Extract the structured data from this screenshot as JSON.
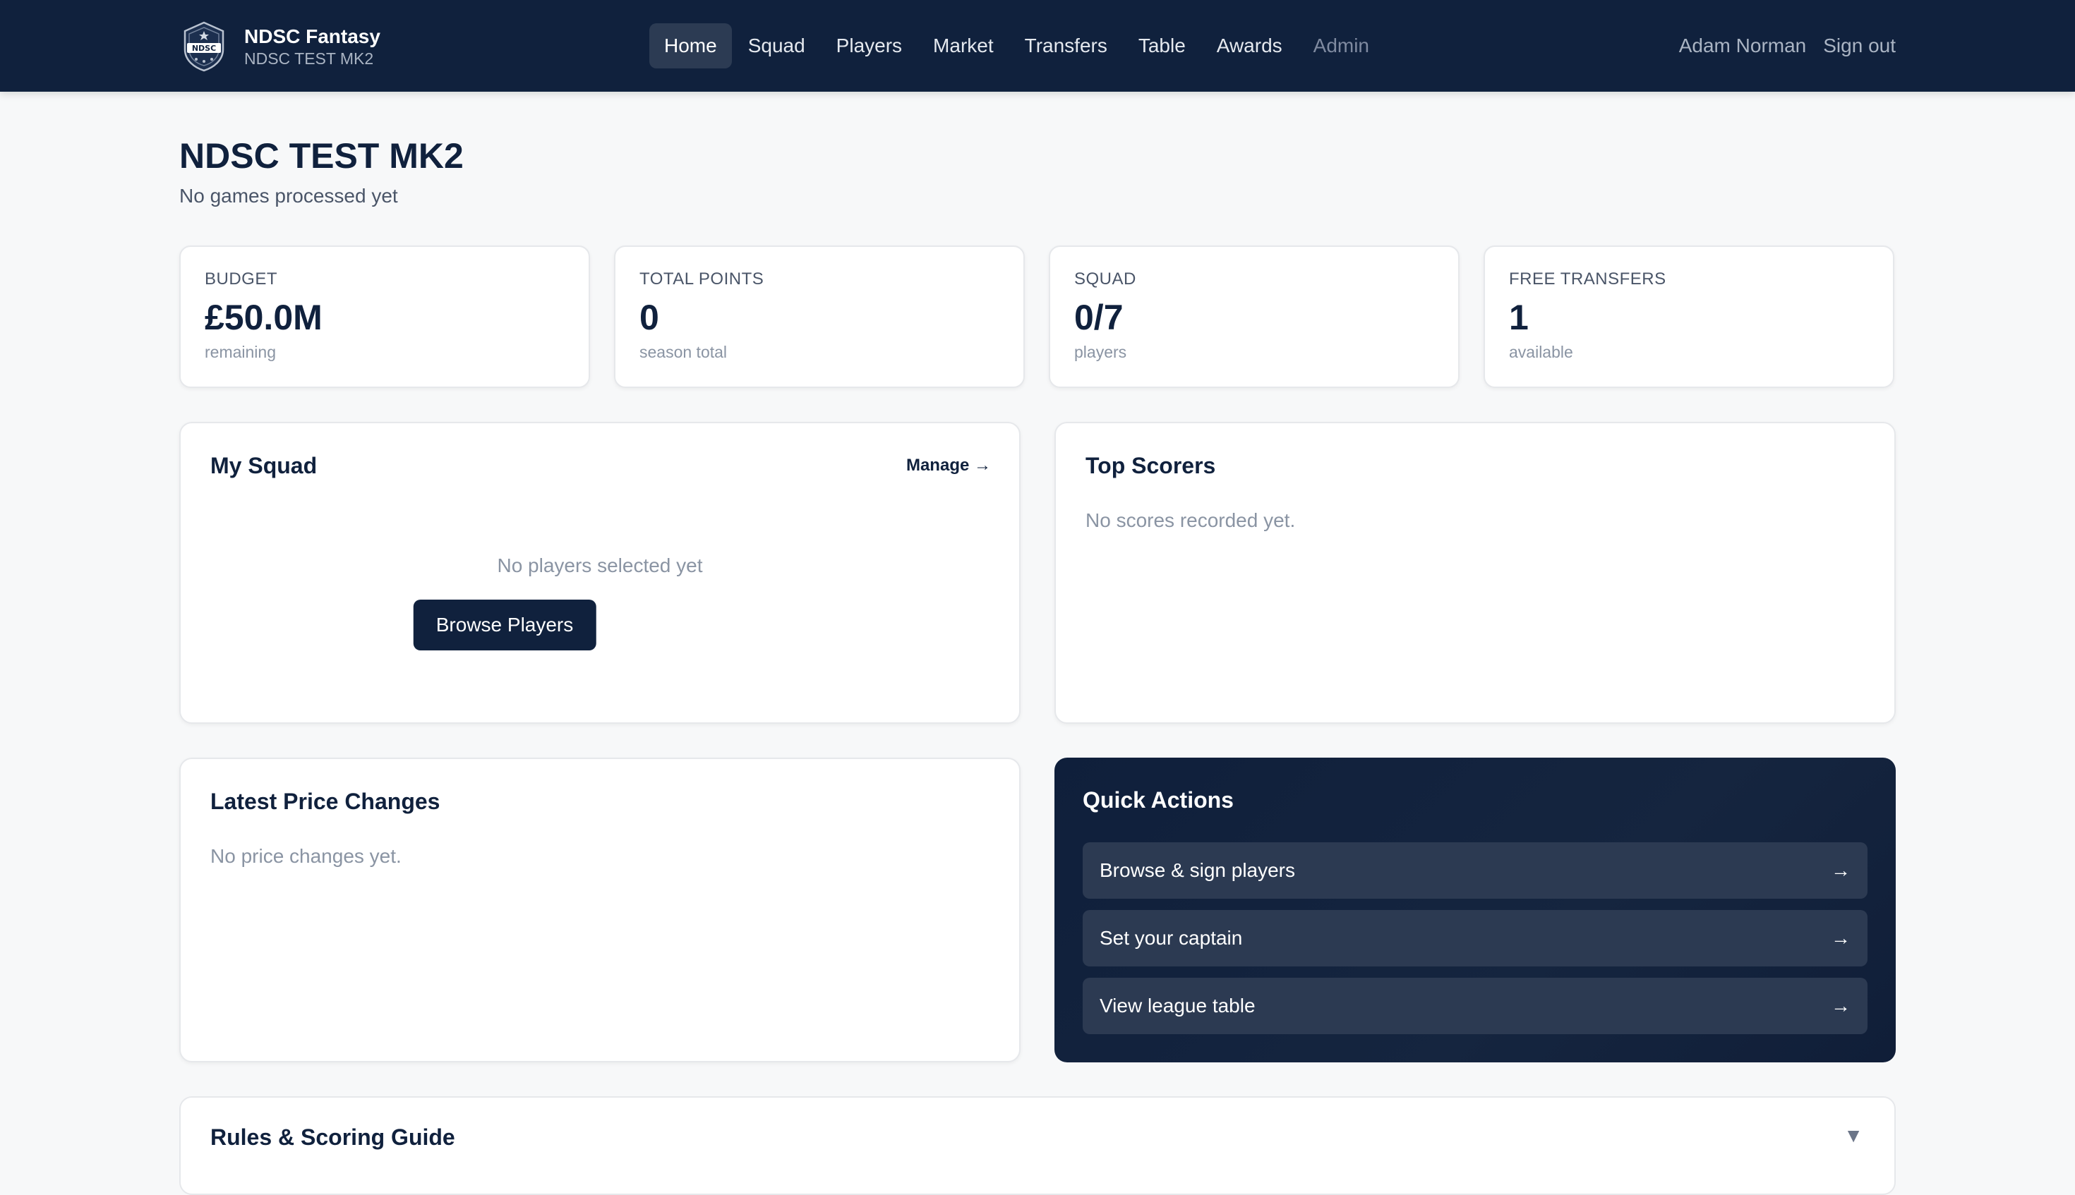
{
  "nav": {
    "brand_title": "NDSC Fantasy",
    "brand_subtitle": "NDSC TEST MK2",
    "logo_text": "NDSC",
    "items": [
      {
        "label": "Home",
        "active": true
      },
      {
        "label": "Squad"
      },
      {
        "label": "Players"
      },
      {
        "label": "Market"
      },
      {
        "label": "Transfers"
      },
      {
        "label": "Table"
      },
      {
        "label": "Awards"
      },
      {
        "label": "Admin",
        "muted": true
      }
    ],
    "user_name": "Adam Norman",
    "sign_out": "Sign out"
  },
  "header": {
    "title": "NDSC TEST MK2",
    "subtitle": "No games processed yet"
  },
  "stats": [
    {
      "label": "BUDGET",
      "value": "£50.0M",
      "note": "remaining"
    },
    {
      "label": "TOTAL POINTS",
      "value": "0",
      "note": "season total"
    },
    {
      "label": "SQUAD",
      "value": "0/7",
      "note": "players"
    },
    {
      "label": "FREE TRANSFERS",
      "value": "1",
      "note": "available"
    }
  ],
  "my_squad": {
    "title": "My Squad",
    "manage": "Manage →",
    "empty": "No players selected yet",
    "browse": "Browse Players"
  },
  "top_scorers": {
    "title": "Top Scorers",
    "empty": "No scores recorded yet."
  },
  "price_changes": {
    "title": "Latest Price Changes",
    "empty": "No price changes yet."
  },
  "quick_actions": {
    "title": "Quick Actions",
    "arrow": "→",
    "items": [
      {
        "label": "Browse & sign players"
      },
      {
        "label": "Set your captain"
      },
      {
        "label": "View league table"
      }
    ]
  },
  "rules": {
    "title": "Rules & Scoring Guide",
    "toggle": "▼"
  },
  "colors": {
    "nav_bg": "#10213d",
    "page_bg": "#f7f8f9",
    "accent_dark": "#10213d",
    "quick_action_button": "#2c3a52"
  }
}
